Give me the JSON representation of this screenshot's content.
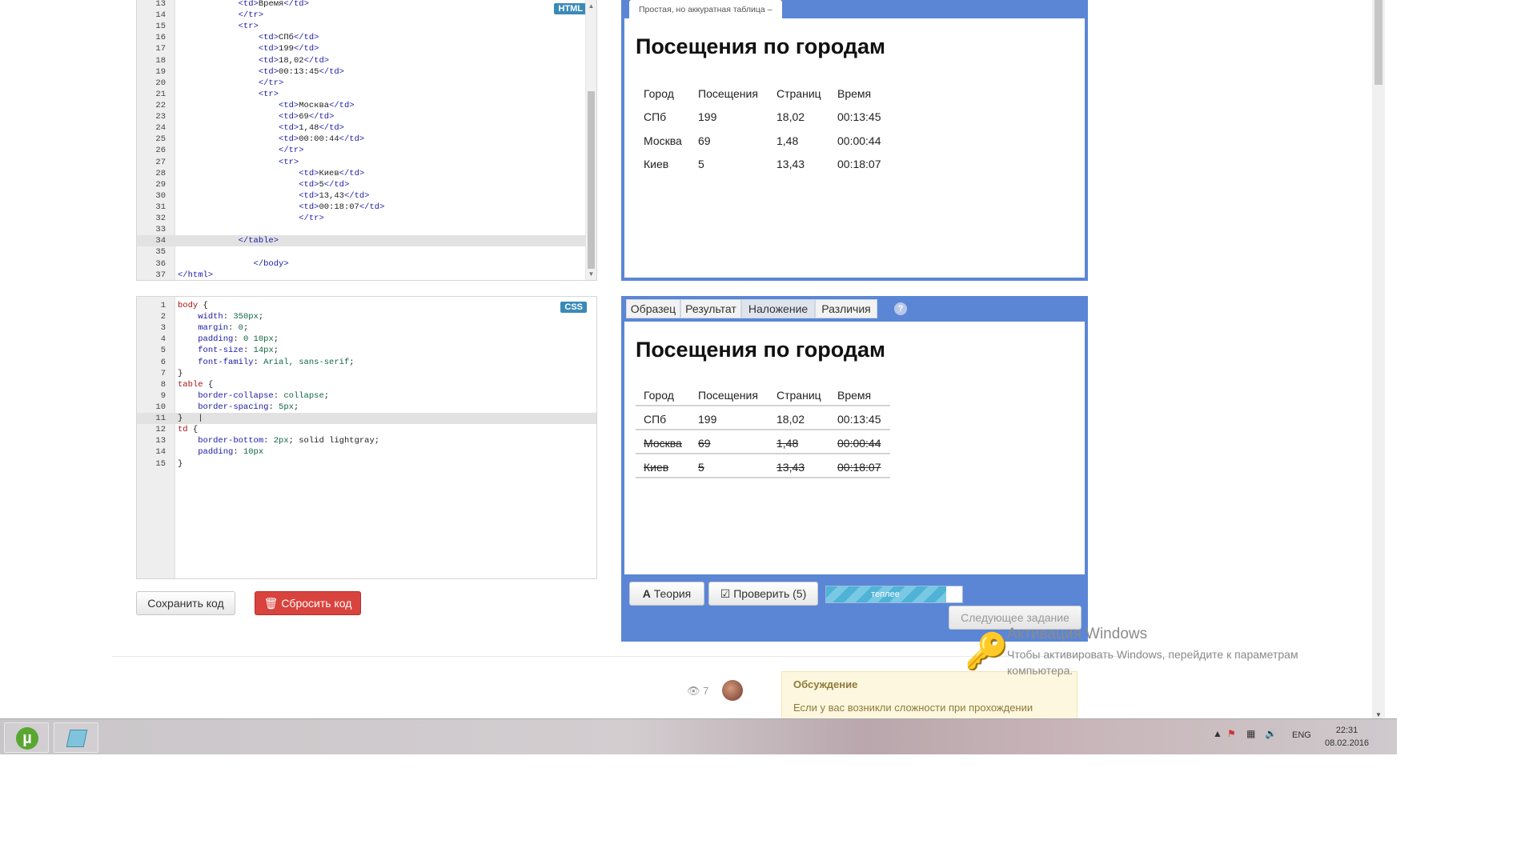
{
  "html_editor": {
    "badge": "HTML",
    "active_line": "34",
    "lines": [
      {
        "n": "13",
        "parts": [
          {
            "t": "            ",
            "c": "txt"
          },
          {
            "t": "<td>",
            "c": "tag"
          },
          {
            "t": "Время",
            "c": "txt"
          },
          {
            "t": "</td>",
            "c": "tag"
          }
        ]
      },
      {
        "n": "14",
        "parts": [
          {
            "t": "            ",
            "c": "txt"
          },
          {
            "t": "</tr>",
            "c": "tag"
          }
        ]
      },
      {
        "n": "15",
        "parts": [
          {
            "t": "            ",
            "c": "txt"
          },
          {
            "t": "<tr>",
            "c": "tag"
          }
        ]
      },
      {
        "n": "16",
        "parts": [
          {
            "t": "                ",
            "c": "txt"
          },
          {
            "t": "<td>",
            "c": "tag"
          },
          {
            "t": "СПб",
            "c": "txt"
          },
          {
            "t": "</td>",
            "c": "tag"
          }
        ]
      },
      {
        "n": "17",
        "parts": [
          {
            "t": "                ",
            "c": "txt"
          },
          {
            "t": "<td>",
            "c": "tag"
          },
          {
            "t": "199",
            "c": "txt"
          },
          {
            "t": "</td>",
            "c": "tag"
          }
        ]
      },
      {
        "n": "18",
        "parts": [
          {
            "t": "                ",
            "c": "txt"
          },
          {
            "t": "<td>",
            "c": "tag"
          },
          {
            "t": "18,02",
            "c": "txt"
          },
          {
            "t": "</td>",
            "c": "tag"
          }
        ]
      },
      {
        "n": "19",
        "parts": [
          {
            "t": "                ",
            "c": "txt"
          },
          {
            "t": "<td>",
            "c": "tag"
          },
          {
            "t": "00:13:45",
            "c": "txt"
          },
          {
            "t": "</td>",
            "c": "tag"
          }
        ]
      },
      {
        "n": "20",
        "parts": [
          {
            "t": "                ",
            "c": "txt"
          },
          {
            "t": "</tr>",
            "c": "tag"
          }
        ]
      },
      {
        "n": "21",
        "parts": [
          {
            "t": "                ",
            "c": "txt"
          },
          {
            "t": "<tr>",
            "c": "tag"
          }
        ]
      },
      {
        "n": "22",
        "parts": [
          {
            "t": "                    ",
            "c": "txt"
          },
          {
            "t": "<td>",
            "c": "tag"
          },
          {
            "t": "Москва",
            "c": "txt"
          },
          {
            "t": "</td>",
            "c": "tag"
          }
        ]
      },
      {
        "n": "23",
        "parts": [
          {
            "t": "                    ",
            "c": "txt"
          },
          {
            "t": "<td>",
            "c": "tag"
          },
          {
            "t": "69",
            "c": "txt"
          },
          {
            "t": "</td>",
            "c": "tag"
          }
        ]
      },
      {
        "n": "24",
        "parts": [
          {
            "t": "                    ",
            "c": "txt"
          },
          {
            "t": "<td>",
            "c": "tag"
          },
          {
            "t": "1,48",
            "c": "txt"
          },
          {
            "t": "</td>",
            "c": "tag"
          }
        ]
      },
      {
        "n": "25",
        "parts": [
          {
            "t": "                    ",
            "c": "txt"
          },
          {
            "t": "<td>",
            "c": "tag"
          },
          {
            "t": "00:00:44",
            "c": "txt"
          },
          {
            "t": "</td>",
            "c": "tag"
          }
        ]
      },
      {
        "n": "26",
        "parts": [
          {
            "t": "                    ",
            "c": "txt"
          },
          {
            "t": "</tr>",
            "c": "tag"
          }
        ]
      },
      {
        "n": "27",
        "parts": [
          {
            "t": "                    ",
            "c": "txt"
          },
          {
            "t": "<tr>",
            "c": "tag"
          }
        ]
      },
      {
        "n": "28",
        "parts": [
          {
            "t": "                        ",
            "c": "txt"
          },
          {
            "t": "<td>",
            "c": "tag"
          },
          {
            "t": "Киев",
            "c": "txt"
          },
          {
            "t": "</td>",
            "c": "tag"
          }
        ]
      },
      {
        "n": "29",
        "parts": [
          {
            "t": "                        ",
            "c": "txt"
          },
          {
            "t": "<td>",
            "c": "tag"
          },
          {
            "t": "5",
            "c": "txt"
          },
          {
            "t": "</td>",
            "c": "tag"
          }
        ]
      },
      {
        "n": "30",
        "parts": [
          {
            "t": "                        ",
            "c": "txt"
          },
          {
            "t": "<td>",
            "c": "tag"
          },
          {
            "t": "13,43",
            "c": "txt"
          },
          {
            "t": "</td>",
            "c": "tag"
          }
        ]
      },
      {
        "n": "31",
        "parts": [
          {
            "t": "                        ",
            "c": "txt"
          },
          {
            "t": "<td>",
            "c": "tag"
          },
          {
            "t": "00:18:07",
            "c": "txt"
          },
          {
            "t": "</td>",
            "c": "tag"
          }
        ]
      },
      {
        "n": "32",
        "parts": [
          {
            "t": "                        ",
            "c": "txt"
          },
          {
            "t": "</tr>",
            "c": "tag"
          }
        ]
      },
      {
        "n": "33",
        "parts": []
      },
      {
        "n": "34",
        "parts": [
          {
            "t": "            ",
            "c": "txt"
          },
          {
            "t": "</table>",
            "c": "tag"
          }
        ]
      },
      {
        "n": "35",
        "parts": []
      },
      {
        "n": "36",
        "parts": [
          {
            "t": "               ",
            "c": "txt"
          },
          {
            "t": "</body>",
            "c": "tag"
          }
        ]
      },
      {
        "n": "37",
        "parts": [
          {
            "t": "</html>",
            "c": "tag"
          }
        ]
      }
    ]
  },
  "css_editor": {
    "badge": "CSS",
    "active_line": "11",
    "lines": [
      {
        "n": "1",
        "parts": [
          {
            "t": "body",
            "c": "sel"
          },
          {
            "t": " {",
            "c": "txt"
          }
        ]
      },
      {
        "n": "2",
        "parts": [
          {
            "t": "    ",
            "c": "txt"
          },
          {
            "t": "width",
            "c": "prop"
          },
          {
            "t": ": ",
            "c": "txt"
          },
          {
            "t": "350px",
            "c": "num"
          },
          {
            "t": ";",
            "c": "txt"
          }
        ]
      },
      {
        "n": "3",
        "parts": [
          {
            "t": "    ",
            "c": "txt"
          },
          {
            "t": "margin",
            "c": "prop"
          },
          {
            "t": ": ",
            "c": "txt"
          },
          {
            "t": "0",
            "c": "num"
          },
          {
            "t": ";",
            "c": "txt"
          }
        ]
      },
      {
        "n": "4",
        "parts": [
          {
            "t": "    ",
            "c": "txt"
          },
          {
            "t": "padding",
            "c": "prop"
          },
          {
            "t": ": ",
            "c": "txt"
          },
          {
            "t": "0 10px",
            "c": "num"
          },
          {
            "t": ";",
            "c": "txt"
          }
        ]
      },
      {
        "n": "5",
        "parts": [
          {
            "t": "    ",
            "c": "txt"
          },
          {
            "t": "font-size",
            "c": "prop"
          },
          {
            "t": ": ",
            "c": "txt"
          },
          {
            "t": "14px",
            "c": "num"
          },
          {
            "t": ";",
            "c": "txt"
          }
        ]
      },
      {
        "n": "6",
        "parts": [
          {
            "t": "    ",
            "c": "txt"
          },
          {
            "t": "font-family",
            "c": "prop"
          },
          {
            "t": ": ",
            "c": "txt"
          },
          {
            "t": "Arial, sans-serif",
            "c": "num"
          },
          {
            "t": ";",
            "c": "txt"
          }
        ]
      },
      {
        "n": "7",
        "parts": [
          {
            "t": "}",
            "c": "txt"
          }
        ]
      },
      {
        "n": "8",
        "parts": [
          {
            "t": "table",
            "c": "sel"
          },
          {
            "t": " {",
            "c": "txt"
          }
        ]
      },
      {
        "n": "9",
        "parts": [
          {
            "t": "    ",
            "c": "txt"
          },
          {
            "t": "border-collapse",
            "c": "prop"
          },
          {
            "t": ": ",
            "c": "txt"
          },
          {
            "t": "collapse",
            "c": "num"
          },
          {
            "t": ";",
            "c": "txt"
          }
        ]
      },
      {
        "n": "10",
        "parts": [
          {
            "t": "    ",
            "c": "txt"
          },
          {
            "t": "border-spacing",
            "c": "prop"
          },
          {
            "t": ": ",
            "c": "txt"
          },
          {
            "t": "5px",
            "c": "num"
          },
          {
            "t": ";",
            "c": "txt"
          }
        ]
      },
      {
        "n": "11",
        "parts": [
          {
            "t": "}   |",
            "c": "txt"
          }
        ]
      },
      {
        "n": "12",
        "parts": [
          {
            "t": "td",
            "c": "sel"
          },
          {
            "t": " {",
            "c": "txt"
          }
        ]
      },
      {
        "n": "13",
        "parts": [
          {
            "t": "    ",
            "c": "txt"
          },
          {
            "t": "border-bottom",
            "c": "prop"
          },
          {
            "t": ": ",
            "c": "txt"
          },
          {
            "t": "2px",
            "c": "num"
          },
          {
            "t": "; solid lightgray;",
            "c": "txt"
          }
        ]
      },
      {
        "n": "14",
        "parts": [
          {
            "t": "    ",
            "c": "txt"
          },
          {
            "t": "padding",
            "c": "prop"
          },
          {
            "t": ": ",
            "c": "txt"
          },
          {
            "t": "10px",
            "c": "num"
          }
        ]
      },
      {
        "n": "15",
        "parts": [
          {
            "t": "}",
            "c": "txt"
          }
        ]
      }
    ]
  },
  "buttons": {
    "save": "Сохранить код",
    "reset": "Сбросить код",
    "theory": "Теория",
    "check": "Проверить (5)",
    "next": "Следующее задание"
  },
  "preview_top": {
    "tab_label": "Простая, но аккуратная таблица –",
    "heading": "Посещения по городам",
    "header": [
      "Город",
      "Посещения",
      "Страниц",
      "Время"
    ],
    "rows": [
      [
        "СПб",
        "199",
        "18,02",
        "00:13:45"
      ],
      [
        "Москва",
        "69",
        "1,48",
        "00:00:44"
      ],
      [
        "Киев",
        "5",
        "13,43",
        "00:18:07"
      ]
    ]
  },
  "preview_bottom": {
    "tabs": [
      "Образец",
      "Результат",
      "Наложение",
      "Различия"
    ],
    "active_tab": "Наложение",
    "help": "?",
    "heading": "Посещения по городам",
    "header": [
      "Город",
      "Посещения",
      "Страниц",
      "Время"
    ],
    "rows": [
      [
        "СПб",
        "199",
        "18,02",
        "00:13:45"
      ],
      [
        "Москва",
        "69",
        "1,48",
        "00:00:44"
      ],
      [
        "Киев",
        "5",
        "13,43",
        "00:18:07"
      ]
    ]
  },
  "progress": {
    "label": "теплее",
    "fraction": 0.88
  },
  "footer": {
    "views": "7",
    "discussion_title": "Обсуждение",
    "discussion_text": "Если у вас возникли сложности при прохождении"
  },
  "watermark": {
    "title": "Активация Windows",
    "line1": "Чтобы активировать Windows, перейдите к параметрам",
    "line2": "компьютера."
  },
  "taskbar": {
    "lang": "ENG",
    "time": "22:31",
    "date": "08.02.2016"
  },
  "colors": {
    "panel": "#5b86d6",
    "reset_button": "#d9433d",
    "progress": "#4fb3d6"
  }
}
